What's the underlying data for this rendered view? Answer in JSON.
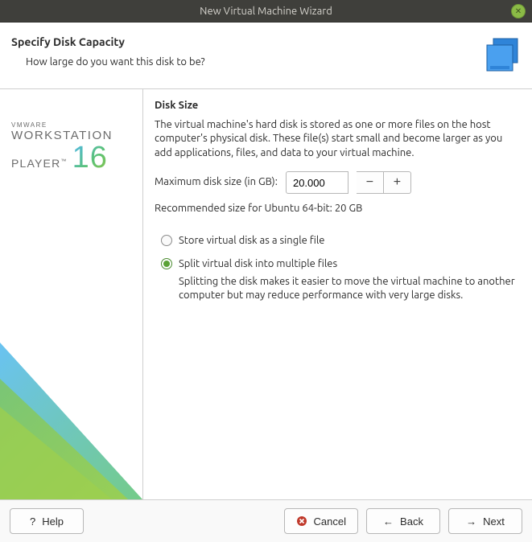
{
  "window": {
    "title": "New Virtual Machine Wizard"
  },
  "header": {
    "title": "Specify Disk Capacity",
    "subtitle": "How large do you want this disk to be?"
  },
  "brand": {
    "vmware": "VMWARE",
    "workstation": "WORKSTATION",
    "player": "PLAYER",
    "tm": "™",
    "version": "16"
  },
  "content": {
    "section_title": "Disk Size",
    "description": "The virtual machine's hard disk is stored as one or more files on the host computer's physical disk. These file(s) start small and become larger as you add applications, files, and data to your virtual machine.",
    "size_label": "Maximum disk size (in GB):",
    "size_value": "20.000",
    "recommended": "Recommended size for Ubuntu 64-bit: 20 GB",
    "option_single": "Store virtual disk as a single file",
    "option_split": "Split virtual disk into multiple files",
    "split_note": "Splitting the disk makes it easier to move the virtual machine to another computer but may reduce performance with very large disks.",
    "selected_option": "split"
  },
  "footer": {
    "help": "Help",
    "cancel": "Cancel",
    "back": "Back",
    "next": "Next"
  }
}
